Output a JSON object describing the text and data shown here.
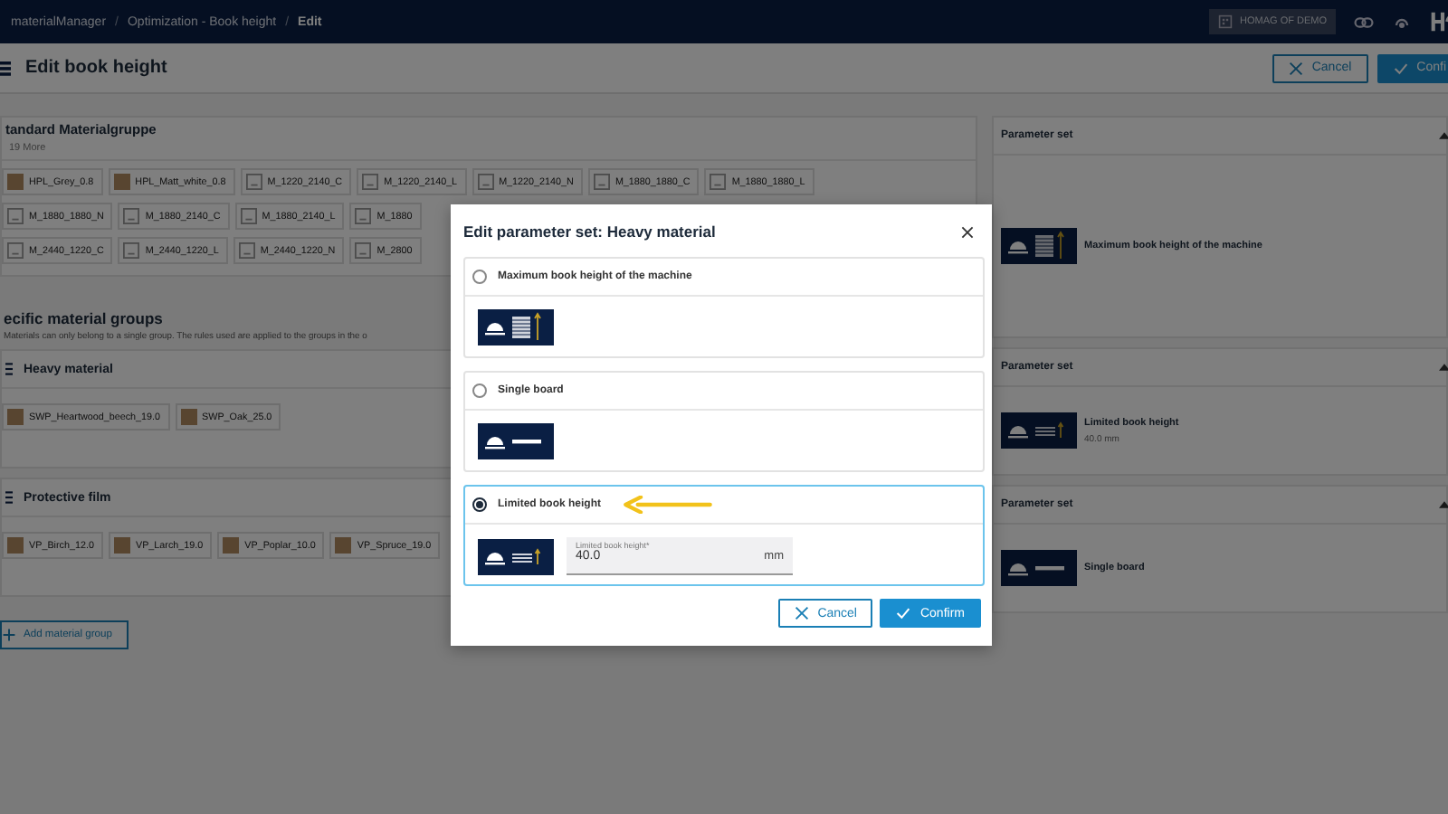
{
  "header": {
    "breadcrumb": [
      "materialManager",
      "Optimization - Book height",
      "Edit"
    ],
    "separator": "/",
    "account": "HOMAG OF DEMO"
  },
  "titlebar": {
    "title": "Edit book height",
    "buttons": [
      {
        "label": "Cancel",
        "kind": "secondary"
      },
      {
        "label": "Confi",
        "kind": "primary"
      }
    ]
  },
  "standard_group": {
    "title": "tandard Materialgruppe",
    "more": "19 More",
    "rows": [
      [
        {
          "label": "HPL_Grey_0.8",
          "kind": "texture"
        },
        {
          "label": "HPL_Matt_white_0.8",
          "kind": "texture"
        },
        {
          "label": "M_1220_2140_C",
          "kind": "image"
        },
        {
          "label": "M_1220_2140_L",
          "kind": "image"
        },
        {
          "label": "M_1220_2140_N",
          "kind": "image"
        },
        {
          "label": "M_1880_1880_C",
          "kind": "image"
        },
        {
          "label": "M_1880_1880_L",
          "kind": "image"
        }
      ],
      [
        {
          "label": "M_1880_1880_N",
          "kind": "image"
        },
        {
          "label": "M_1880_2140_C",
          "kind": "image"
        },
        {
          "label": "M_1880_2140_L",
          "kind": "image"
        },
        {
          "label": "M_1880",
          "kind": "image"
        }
      ],
      [
        {
          "label": "M_2440_1220_C",
          "kind": "image"
        },
        {
          "label": "M_2440_1220_L",
          "kind": "image"
        },
        {
          "label": "M_2440_1220_N",
          "kind": "image"
        },
        {
          "label": "M_2800",
          "kind": "image"
        }
      ]
    ]
  },
  "specific_groups": {
    "title": "ecific material groups",
    "note": "Materials can only belong to a single group. The rules used are applied to the groups in the o",
    "groups": [
      {
        "name": "Heavy material",
        "materials": [
          {
            "label": "SWP_Heartwood_beech_19.0",
            "kind": "texture"
          },
          {
            "label": "SWP_Oak_25.0",
            "kind": "texture"
          }
        ]
      },
      {
        "name": "Protective film",
        "materials": [
          {
            "label": "VP_Birch_12.0",
            "kind": "texture"
          },
          {
            "label": "VP_Larch_19.0",
            "kind": "texture"
          },
          {
            "label": "VP_Poplar_10.0",
            "kind": "texture"
          },
          {
            "label": "VP_Spruce_19.0",
            "kind": "texture"
          }
        ]
      }
    ],
    "add_button": "Add material group"
  },
  "parameter_sets": [
    {
      "title": "Parameter set",
      "expanded": true,
      "kind": "max",
      "label": "Maximum book height of the machine"
    },
    {
      "title": "Parameter set",
      "expanded": true,
      "kind": "limited",
      "label": "Limited book height",
      "detail": "40.0 mm"
    },
    {
      "title": "Parameter set",
      "expanded": true,
      "kind": "single",
      "label": "Single board"
    }
  ],
  "dialog": {
    "title": "Edit parameter set: Heavy material",
    "options": [
      {
        "label": "Maximum book height of the machine",
        "kind": "max",
        "selected": false
      },
      {
        "label": "Single board",
        "kind": "single",
        "selected": false
      },
      {
        "label": "Limited book height",
        "kind": "limited",
        "selected": true,
        "field": {
          "label": "Limited book height*",
          "value": "40.0",
          "unit": "mm"
        }
      }
    ],
    "buttons": [
      {
        "label": "Cancel",
        "kind": "secondary"
      },
      {
        "label": "Confirm",
        "kind": "primary"
      }
    ]
  }
}
